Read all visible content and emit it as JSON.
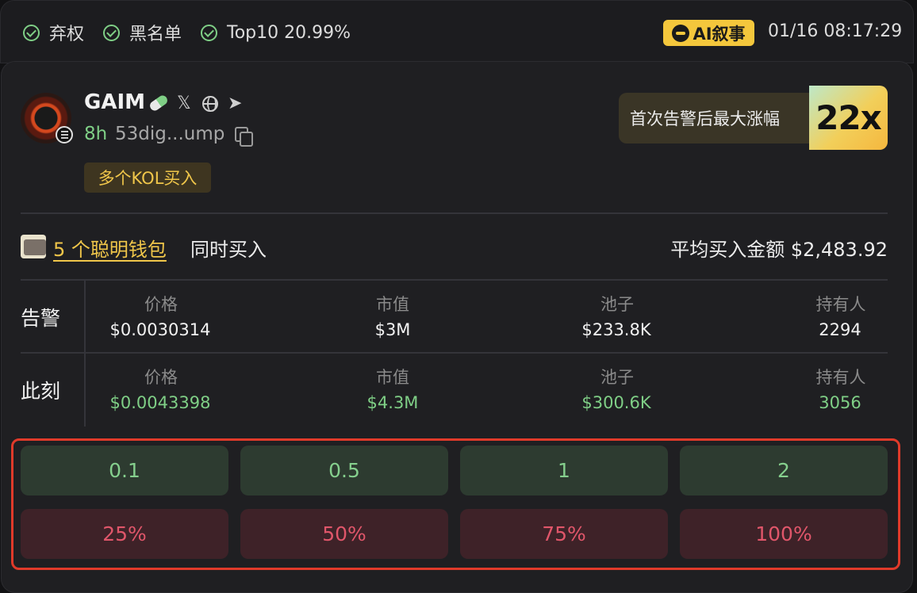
{
  "header": {
    "flags": [
      "弃权",
      "黑名单",
      "Top10 20.99%"
    ],
    "ai_badge": "AI叙事",
    "timestamp": "01/16 08:17:29"
  },
  "token": {
    "name": "GAIM",
    "age": "8h",
    "address": "53dig...ump",
    "tag": "多个KOL买入",
    "social_icons": [
      "pill-icon",
      "x-icon",
      "globe-icon",
      "telegram-icon"
    ]
  },
  "gain": {
    "label": "首次告警后最大涨幅",
    "value": "22x"
  },
  "smart_wallets": {
    "link": "5 个聪明钱包",
    "suffix": "同时买入",
    "avg_buy": "平均买入金额 $2,483.92"
  },
  "stats": {
    "columns": [
      "价格",
      "市值",
      "池子",
      "持有人"
    ],
    "rows": [
      {
        "label": "告警",
        "values": [
          "$0.0030314",
          "$3M",
          "$233.8K",
          "2294"
        ]
      },
      {
        "label": "此刻",
        "values": [
          "$0.0043398",
          "$4.3M",
          "$300.6K",
          "3056"
        ]
      }
    ]
  },
  "actions": {
    "buy": [
      "0.1",
      "0.5",
      "1",
      "2"
    ],
    "sell": [
      "25%",
      "50%",
      "75%",
      "100%"
    ]
  },
  "colors": {
    "accent_gold": "#f0c64a",
    "positive_green": "#7fcf86",
    "sell_red": "#e0566a",
    "highlight_border": "#e03a2a"
  }
}
